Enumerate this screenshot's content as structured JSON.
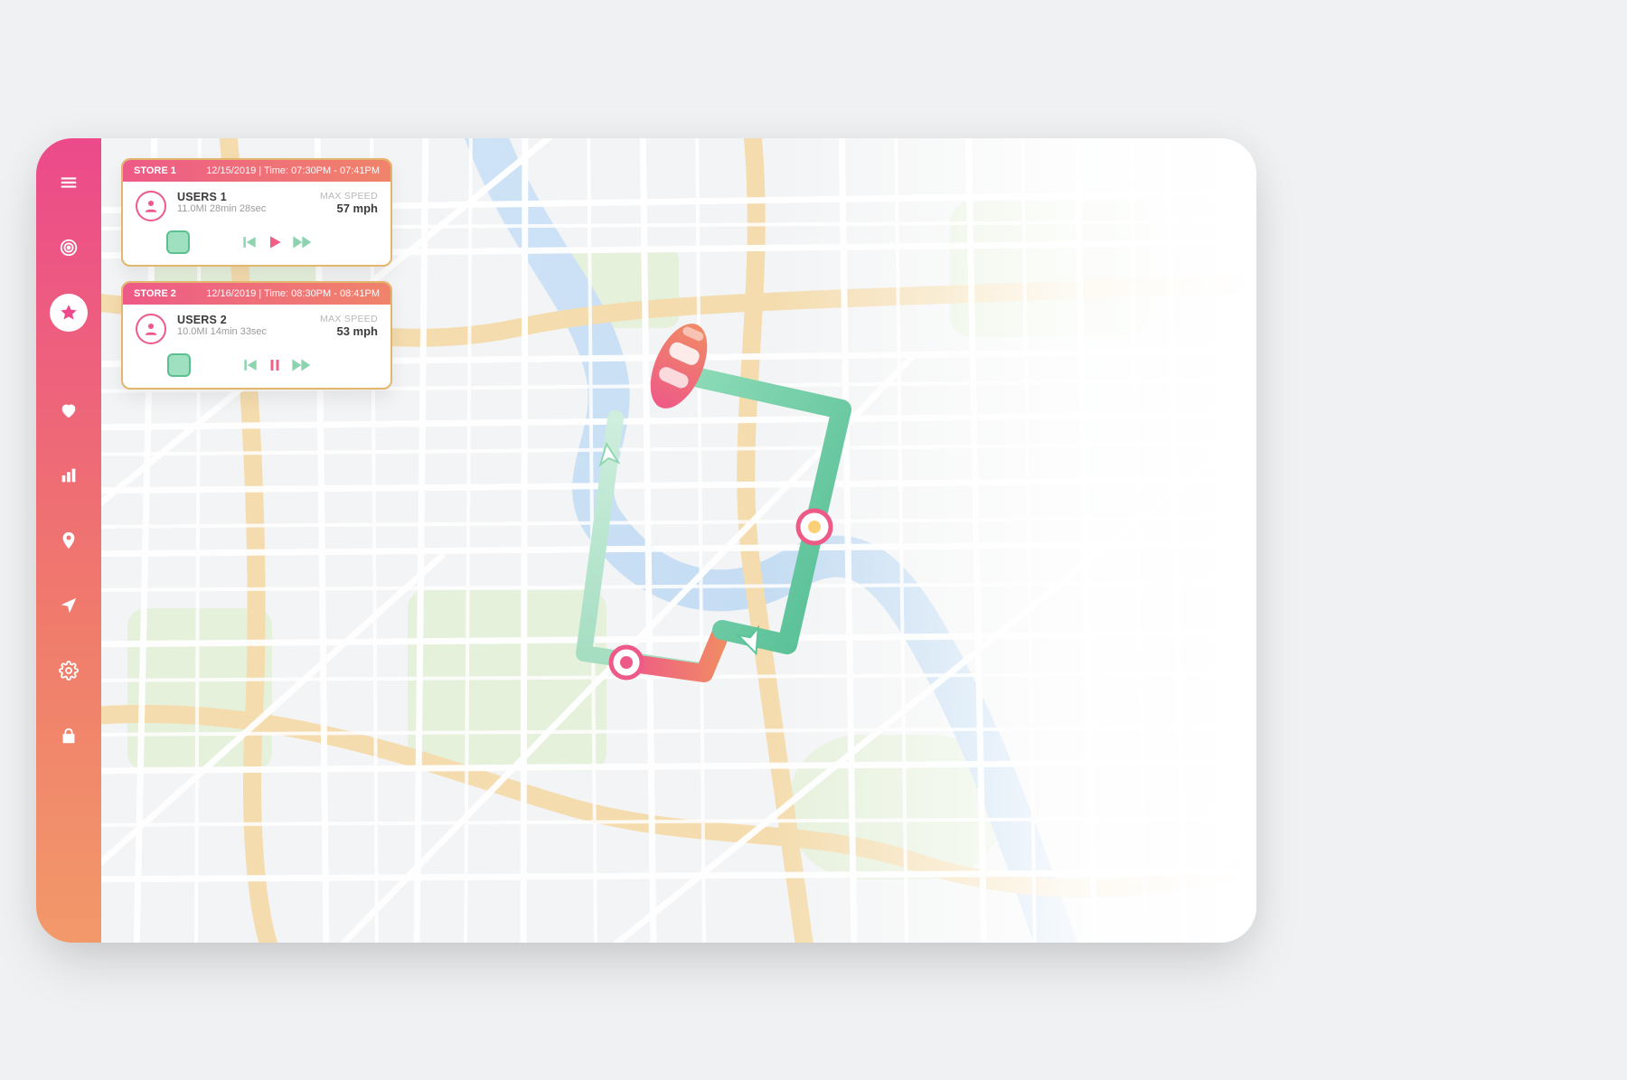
{
  "sidebar": {
    "items": [
      {
        "name": "menu-icon"
      },
      {
        "name": "target-icon"
      },
      {
        "name": "star-icon",
        "active": true
      },
      {
        "name": "heart-icon"
      },
      {
        "name": "bar-chart-icon"
      },
      {
        "name": "pin-icon"
      },
      {
        "name": "navigation-icon"
      },
      {
        "name": "gear-icon"
      },
      {
        "name": "lock-icon"
      }
    ]
  },
  "cards": [
    {
      "store_label": "STORE 1",
      "datetime": "12/15/2019  |  Time: 07:30PM - 07:41PM",
      "user_label": "USERS 1",
      "user_sub": "11.0MI 28min 28sec",
      "max_speed_label": "MAX SPEED",
      "max_speed_value": "57 mph",
      "state": "play"
    },
    {
      "store_label": "STORE 2",
      "datetime": "12/16/2019  |  Time: 08:30PM - 08:41PM",
      "user_label": "USERS 2",
      "user_sub": "10.0MI 14min 33sec",
      "max_speed_label": "MAX SPEED",
      "max_speed_value": "53 mph",
      "state": "pause"
    }
  ],
  "colors": {
    "brand_pink": "#ec4a8b",
    "brand_orange": "#f2996a",
    "route_green": "#6ac9a2",
    "route_red": "#ef5d6d"
  }
}
